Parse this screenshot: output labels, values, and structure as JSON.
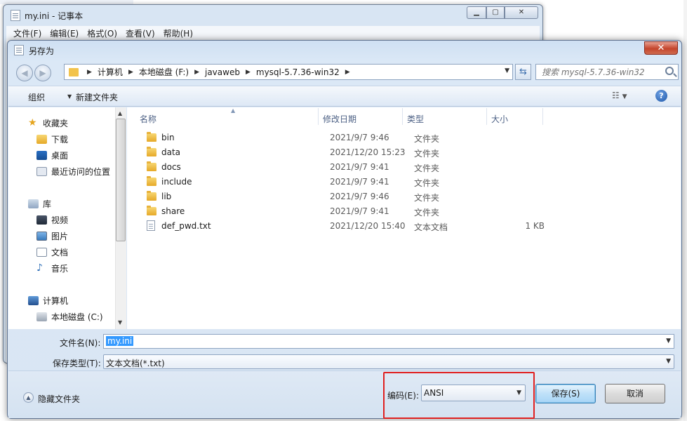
{
  "notepad": {
    "title": "my.ini - 记事本",
    "menu": [
      "文件(F)",
      "编辑(E)",
      "格式(O)",
      "查看(V)",
      "帮助(H)"
    ]
  },
  "dialog": {
    "title": "另存为",
    "close_label": "✕"
  },
  "address": {
    "crumbs": [
      "计算机",
      "本地磁盘 (F:)",
      "javaweb",
      "mysql-5.7.36-win32"
    ]
  },
  "search": {
    "placeholder": "搜索 mysql-5.7.36-win32"
  },
  "toolbar": {
    "organize": "组织",
    "new_folder": "新建文件夹",
    "help": "?"
  },
  "nav": {
    "favorites": "收藏夹",
    "downloads": "下载",
    "desktop": "桌面",
    "recent": "最近访问的位置",
    "libraries": "库",
    "videos": "视频",
    "pictures": "图片",
    "documents": "文档",
    "music": "音乐",
    "computer": "计算机",
    "local_disk_c": "本地磁盘 (C:)"
  },
  "columns": {
    "name": "名称",
    "modified": "修改日期",
    "type": "类型",
    "size": "大小"
  },
  "files": [
    {
      "name": "bin",
      "modified": "2021/9/7 9:46",
      "type": "文件夹",
      "size": "",
      "icon": "folder-icon"
    },
    {
      "name": "data",
      "modified": "2021/12/20 15:23",
      "type": "文件夹",
      "size": "",
      "icon": "folder-icon"
    },
    {
      "name": "docs",
      "modified": "2021/9/7 9:41",
      "type": "文件夹",
      "size": "",
      "icon": "folder-icon"
    },
    {
      "name": "include",
      "modified": "2021/9/7 9:41",
      "type": "文件夹",
      "size": "",
      "icon": "folder-icon"
    },
    {
      "name": "lib",
      "modified": "2021/9/7 9:46",
      "type": "文件夹",
      "size": "",
      "icon": "folder-icon"
    },
    {
      "name": "share",
      "modified": "2021/9/7 9:41",
      "type": "文件夹",
      "size": "",
      "icon": "folder-icon"
    },
    {
      "name": "def_pwd.txt",
      "modified": "2021/12/20 15:40",
      "type": "文本文档",
      "size": "1 KB",
      "icon": "text-file-icon"
    }
  ],
  "form": {
    "filename_label": "文件名(N):",
    "filename_value": "my.ini",
    "filetype_label": "保存类型(T):",
    "filetype_value": "文本文档(*.txt)"
  },
  "footer": {
    "hide_folders": "隐藏文件夹",
    "encoding_label": "编码(E):",
    "encoding_value": "ANSI",
    "save": "保存(S)",
    "cancel": "取消"
  },
  "colors": {
    "highlight_box": "#e02020",
    "selection": "#3399ff"
  }
}
